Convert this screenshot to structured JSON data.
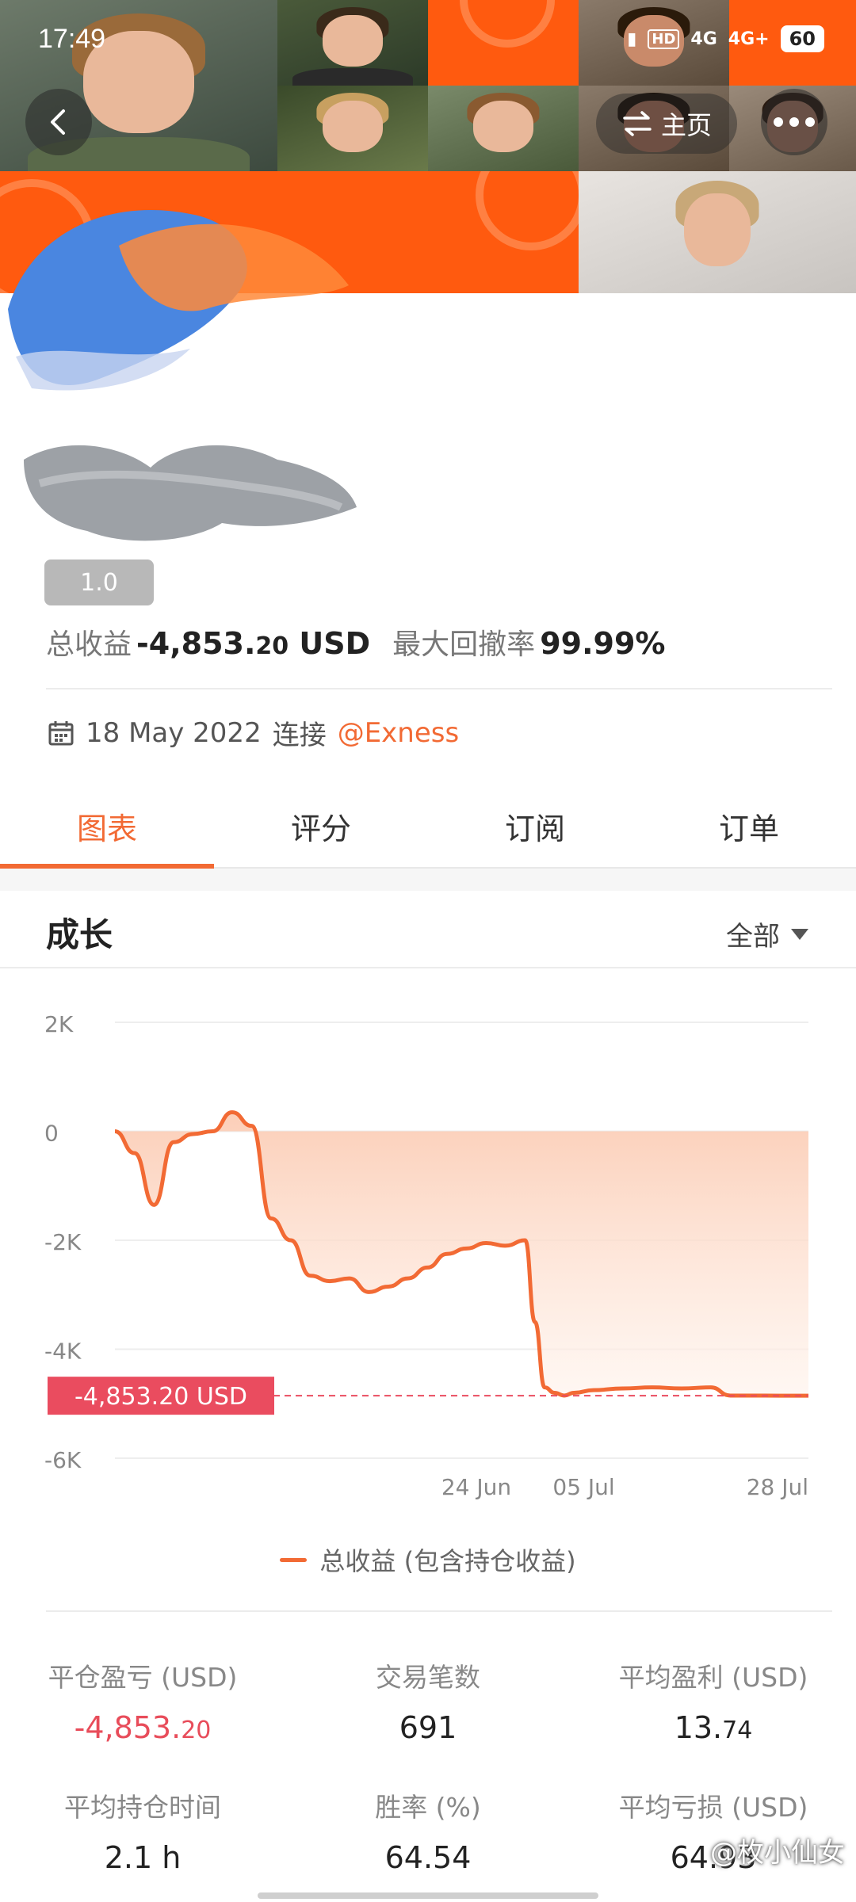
{
  "status_bar": {
    "time": "17:49",
    "signal_1": "4G",
    "signal_2": "4G+",
    "battery": "60"
  },
  "header": {
    "home_label": "主页",
    "badge": "1.0"
  },
  "summary": {
    "total_profit_label": "总收益",
    "total_profit_value": "-4,853.",
    "total_profit_decimals": "20",
    "total_profit_currency": " USD",
    "max_drawdown_label": "最大回撤率",
    "max_drawdown_value": "99.99%"
  },
  "connection": {
    "date": "18 May 2022",
    "connected_label": "连接",
    "broker": "@Exness"
  },
  "tabs": [
    {
      "label": "图表",
      "active": true
    },
    {
      "label": "评分",
      "active": false
    },
    {
      "label": "订阅",
      "active": false
    },
    {
      "label": "订单",
      "active": false
    }
  ],
  "growth": {
    "title": "成长",
    "range": "全部"
  },
  "chart_data": {
    "type": "area",
    "series": [
      {
        "name": "总收益 (包含持仓收益)",
        "x": [
          "2022-05-18",
          "2022-05-20",
          "2022-05-22",
          "2022-05-24",
          "2022-05-26",
          "2022-05-28",
          "2022-05-30",
          "2022-06-01",
          "2022-06-03",
          "2022-06-05",
          "2022-06-07",
          "2022-06-09",
          "2022-06-11",
          "2022-06-13",
          "2022-06-15",
          "2022-06-17",
          "2022-06-19",
          "2022-06-21",
          "2022-06-23",
          "2022-06-25",
          "2022-06-27",
          "2022-06-29",
          "2022-06-30",
          "2022-07-01",
          "2022-07-02",
          "2022-07-03",
          "2022-07-04",
          "2022-07-06",
          "2022-07-09",
          "2022-07-12",
          "2022-07-15",
          "2022-07-18",
          "2022-07-20",
          "2022-07-22",
          "2022-07-25",
          "2022-07-28"
        ],
        "values": [
          0,
          -400,
          -1350,
          -200,
          -50,
          0,
          350,
          100,
          -1600,
          -2000,
          -2650,
          -2750,
          -2700,
          -2950,
          -2850,
          -2700,
          -2500,
          -2250,
          -2150,
          -2050,
          -2100,
          -2000,
          -3500,
          -4700,
          -4800,
          -4850,
          -4800,
          -4750,
          -4720,
          -4700,
          -4720,
          -4700,
          -4850,
          -4850,
          -4853.2,
          -4853.2
        ]
      }
    ],
    "y_ticks": [
      "2K",
      "0",
      "-2K",
      "-4K",
      "-6K"
    ],
    "x_ticks": [
      "24 Jun",
      "05 Jul",
      "28 Jul"
    ],
    "ylim": [
      -6000,
      2000
    ],
    "current_value_label": "-4,853.20 USD",
    "current_value": -4853.2,
    "grid": true,
    "legend": "bottom-center",
    "line_color": "#f26a34",
    "marker_color": "#ea4c5f"
  },
  "legend_label": "总收益 (包含持仓收益)",
  "metrics": {
    "closed_pnl_label": "平仓盈亏 (USD)",
    "closed_pnl_value": "-4,853.",
    "closed_pnl_decimals": "20",
    "trades_label": "交易笔数",
    "trades_value": "691",
    "avg_profit_label": "平均盈利 (USD)",
    "avg_profit_value": "13.",
    "avg_profit_decimals": "74",
    "avg_hold_label": "平均持仓时间",
    "avg_hold_value": "2.1 h",
    "win_rate_label": "胜率 (%)",
    "win_rate_value": "64.54",
    "avg_loss_label": "平均亏损 (USD)",
    "avg_loss_value": "64.93"
  },
  "watermark": "@枚小仙女",
  "colors": {
    "accent": "#f26a34",
    "negative": "#e84c5a",
    "banner_orange": "#ff5a0f"
  }
}
